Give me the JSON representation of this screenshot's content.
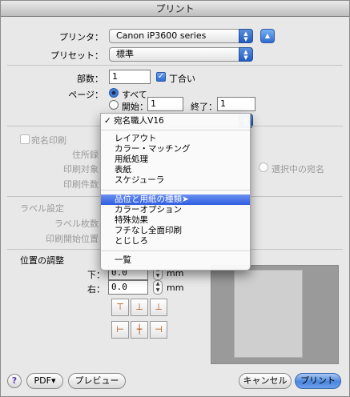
{
  "window": {
    "title": "プリント"
  },
  "printer": {
    "label": "プリンタ：",
    "value": "Canon iP3600 series"
  },
  "preset": {
    "label": "プリセット：",
    "value": "標準"
  },
  "copies": {
    "label": "部数：",
    "value": "1",
    "collate_label": "丁合い",
    "collate_checked": true
  },
  "pages": {
    "label": "ページ：",
    "all_label": "すべて",
    "from_label": "開始：",
    "from_value": "1",
    "to_label": "終了：",
    "to_value": "1"
  },
  "background": {
    "address_print_label": "宛名印刷",
    "address_book_label": "住所録",
    "print_target_label": "印刷対象",
    "selected_address_label": "選択中の宛名",
    "print_count_label": "印刷件数",
    "label_settings_heading": "ラベル設定",
    "label_count_label": "ラベル枚数",
    "print_start_label": "印刷開始位置"
  },
  "position": {
    "heading": "位置の調整",
    "bottom_label": "下：",
    "bottom_value": "0.0",
    "right_label": "右：",
    "right_value": "0.0",
    "unit": "mm"
  },
  "menu": {
    "checked_item": "宛名職人V16",
    "items": [
      "レイアウト",
      "カラー・マッチング",
      "用紙処理",
      "表紙",
      "スケジューラ"
    ],
    "items2": [
      "品位と用紙の種類",
      "カラーオプション",
      "特殊効果",
      "フチなし全面印刷",
      "とじしろ"
    ],
    "highlighted": "品位と用紙の種類",
    "summary": "一覧"
  },
  "bottom": {
    "help": "?",
    "pdf": "PDF▾",
    "preview": "プレビュー",
    "cancel": "キャンセル",
    "print": "プリント"
  },
  "icons": {
    "disclosure": "disclosure-triangle-icon",
    "align_top": "align-top-icon",
    "align_middle": "align-middle-icon",
    "align_bottom": "align-bottom-icon",
    "align_left": "align-left-icon",
    "align_center": "align-center-icon",
    "align_right": "align-right-icon"
  },
  "colors": {
    "accent": "#2f5fe0",
    "default_button": "#4a86dd"
  }
}
